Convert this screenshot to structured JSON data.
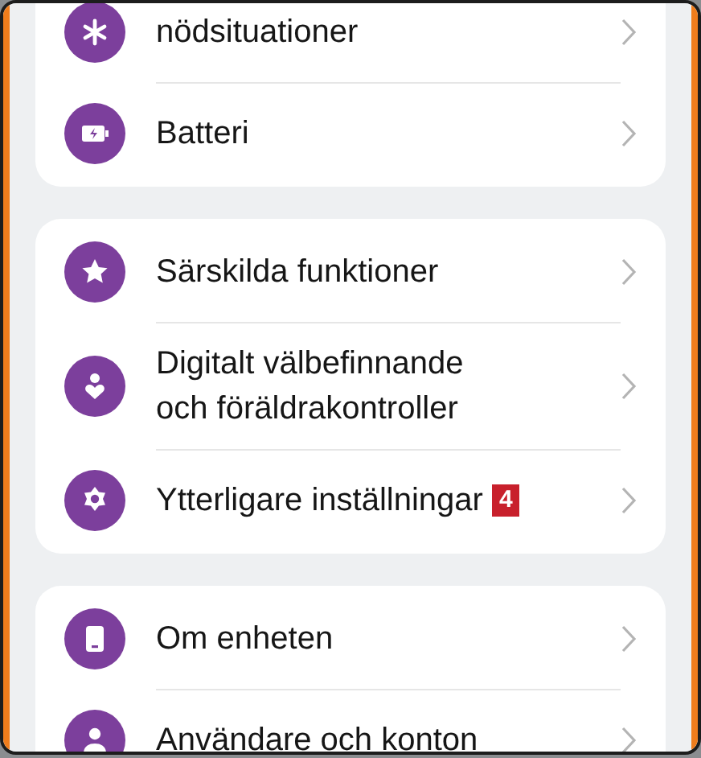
{
  "sections": [
    {
      "items": [
        {
          "kind": "emergency",
          "label": "nödsituationer"
        },
        {
          "kind": "battery",
          "label": "Batteri"
        }
      ]
    },
    {
      "items": [
        {
          "kind": "star",
          "label": "Särskilda funktioner"
        },
        {
          "kind": "wellbeing",
          "label": "Digitalt välbefinnande\noch föräldrakontroller"
        },
        {
          "kind": "gear",
          "label": "Ytterligare inställningar",
          "badge": "4"
        }
      ]
    },
    {
      "items": [
        {
          "kind": "device",
          "label": "Om enheten"
        },
        {
          "kind": "user",
          "label": "Användare och konton"
        }
      ]
    }
  ]
}
